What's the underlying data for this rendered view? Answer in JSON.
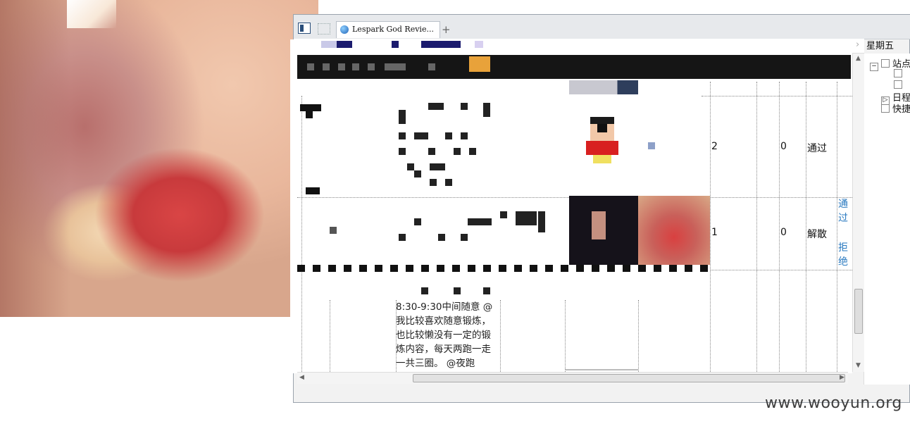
{
  "browser": {
    "tab_title": "Lespark God Revie...",
    "new_tab_label": "+",
    "date_label": "星期五",
    "side_panel": {
      "items": [
        "站点",
        "日程",
        "快捷"
      ]
    }
  },
  "table": {
    "rows": [
      {
        "count": "2",
        "flag": "0",
        "status": "通过",
        "actions": []
      },
      {
        "count": "1",
        "flag": "0",
        "status": "解散",
        "actions": [
          "通过",
          "拒绝"
        ]
      }
    ]
  },
  "post_text": "8:30-9:30中间随意 @我比较喜欢随意锻炼，也比较懒没有一定的锻炼内容，每天两跑一走一共三圈。 @夜跑",
  "watermark": "www.wooyun.org",
  "colors": {
    "link": "#2a7ac0",
    "band": "#151515",
    "accent_orange": "#e8a23a"
  }
}
